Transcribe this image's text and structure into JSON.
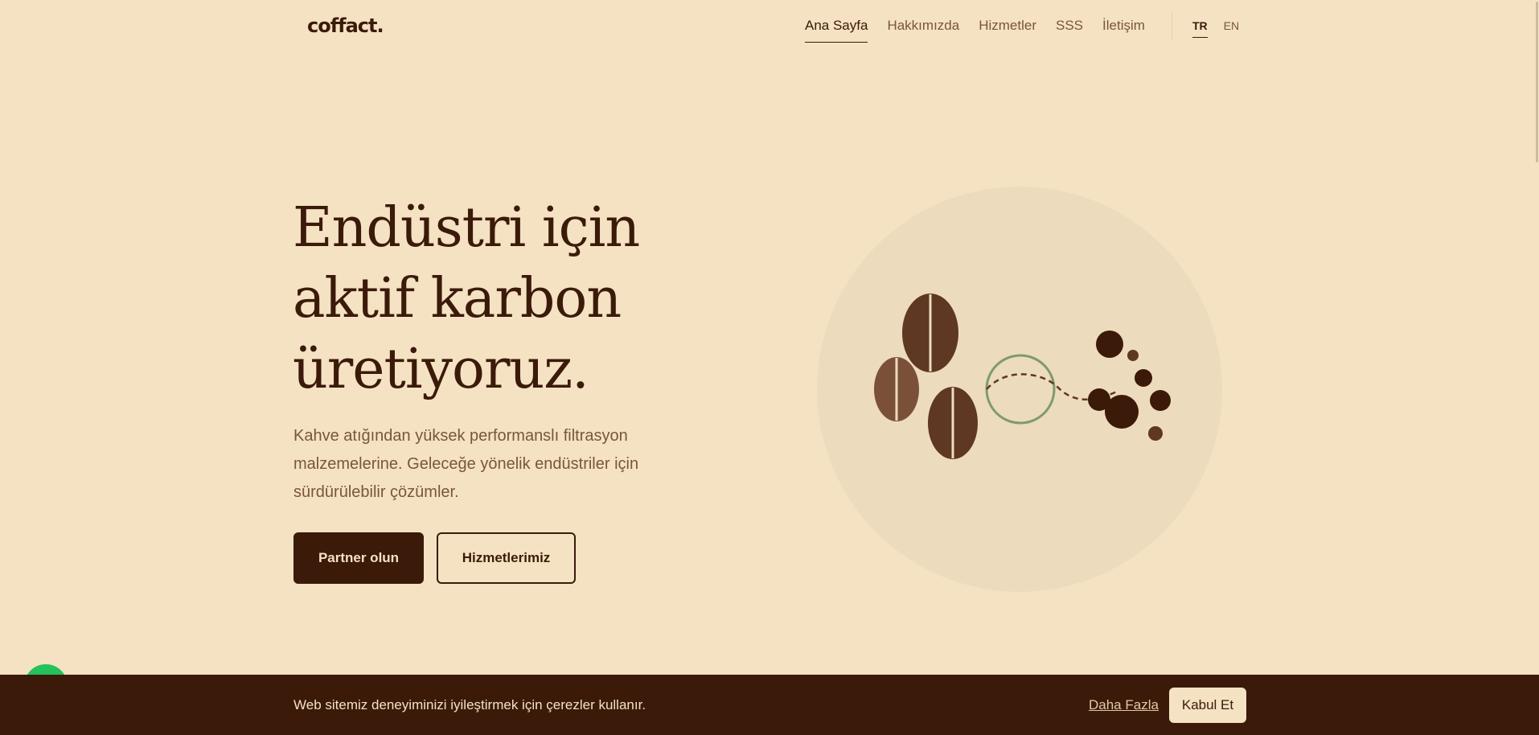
{
  "header": {
    "logo": "coffact.",
    "nav": [
      {
        "label": "Ana Sayfa",
        "active": true
      },
      {
        "label": "Hakkımızda",
        "active": false
      },
      {
        "label": "Hizmetler",
        "active": false
      },
      {
        "label": "SSS",
        "active": false
      },
      {
        "label": "İletişim",
        "active": false
      }
    ],
    "lang": [
      {
        "label": "TR",
        "active": true
      },
      {
        "label": "EN",
        "active": false
      }
    ]
  },
  "hero": {
    "title_line1": "Endüstri için",
    "title_line2": "aktif karbon",
    "title_line3": "üretiyoruz.",
    "subtitle": "Kahve atığından yüksek performanslı filtrasyon malzemelerine. Geleceğe yönelik endüstriler için sürdürülebilir çözümler.",
    "primary_button": "Partner olun",
    "secondary_button": "Hizmetlerimiz"
  },
  "cookie": {
    "text": "Web sitemiz deneyiminizi iyileştirmek için çerezler kullanır.",
    "more_link": "Daha Fazla",
    "accept_button": "Kabul Et"
  },
  "colors": {
    "background": "#f4e2c3",
    "brand_dark": "#3b1a0a",
    "muted_text": "#7a5638",
    "circle_bg": "#eddbbd",
    "whatsapp_green": "#25c15a",
    "ring_green": "#7f9a72"
  },
  "icons": {
    "whatsapp": "whatsapp-icon",
    "coffee_bean": "coffee-bean-icon"
  }
}
